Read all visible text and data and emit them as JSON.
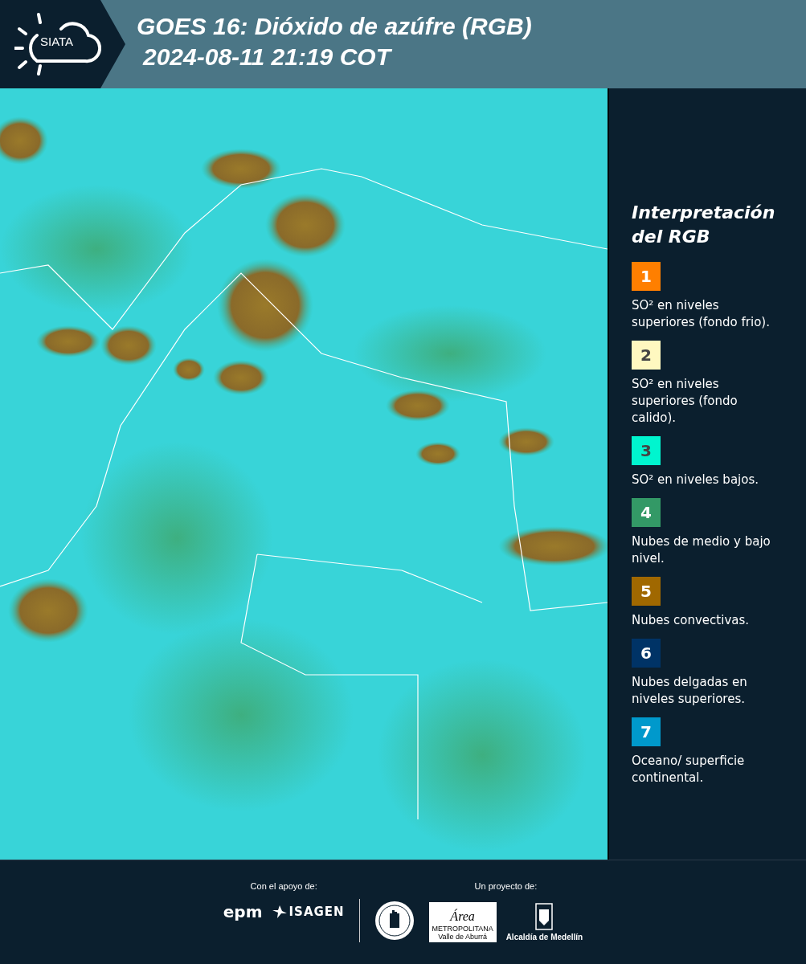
{
  "header": {
    "logo_text": "SIATA",
    "title": "GOES 16: Dióxido de azúfre (RGB)",
    "timestamp": "2024-08-11 21:19 COT"
  },
  "legend": {
    "title": "Interpretación del RGB",
    "items": [
      {
        "number": "1",
        "color": "#ff7f00",
        "text": "SO² en niveles superiores (fondo frio)."
      },
      {
        "number": "2",
        "color": "#fff8c0",
        "text": "SO² en niveles superiores (fondo calido)."
      },
      {
        "number": "3",
        "color": "#00f5cf",
        "text": "SO² en niveles bajos."
      },
      {
        "number": "4",
        "color": "#339966",
        "text": "Nubes de medio y bajo nivel."
      },
      {
        "number": "5",
        "color": "#a06800",
        "text": "Nubes convectivas."
      },
      {
        "number": "6",
        "color": "#003366",
        "text": "Nubes delgadas en niveles superiores."
      },
      {
        "number": "7",
        "color": "#0099cc",
        "text": "Oceano/ superficie continental."
      }
    ]
  },
  "footer": {
    "support_label": "Con el apoyo de:",
    "supporters": [
      "epm",
      "ISAGEN"
    ],
    "project_label": "Un proyecto de:",
    "area_logo": {
      "name": "Área",
      "line1": "METROPOLITANA",
      "line2": "Valle de Aburrá"
    },
    "alcaldia": "Alcaldía de Medellín"
  }
}
